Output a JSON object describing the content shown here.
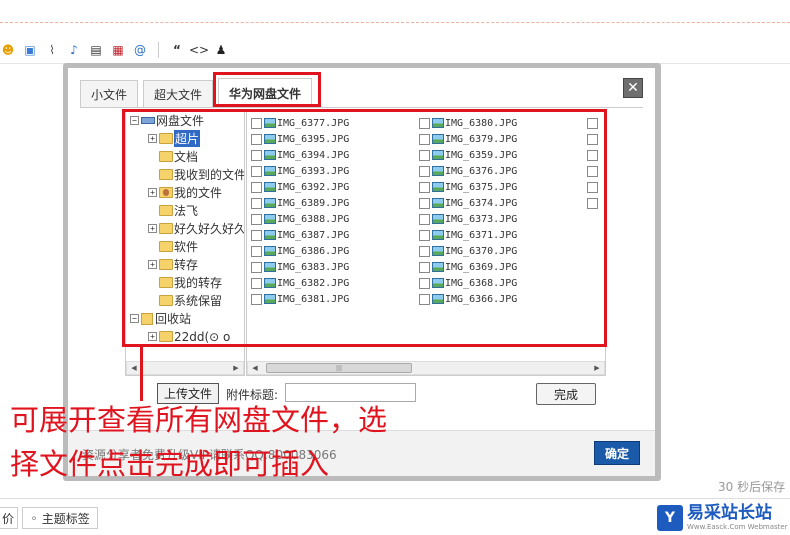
{
  "toolbar": {
    "icons": [
      "emoji-icon",
      "image-icon",
      "attachment-icon",
      "music-icon",
      "video-icon",
      "flash-icon",
      "at-icon",
      "quote-icon",
      "code-icon",
      "qq-icon"
    ],
    "at_glyph": "@",
    "quote_glyph": "“",
    "code_glyph": "<>"
  },
  "dialog": {
    "tabs": [
      {
        "label": "小文件",
        "active": false
      },
      {
        "label": "超大文件",
        "active": false
      },
      {
        "label": "华为网盘文件",
        "active": true
      }
    ],
    "close_glyph": "✕",
    "tree": {
      "toggle_minus": "−",
      "toggle_plus": "+",
      "root": "网盘文件",
      "items": [
        "超片",
        "文档",
        "我收到的文件",
        "我的文件",
        "法飞",
        "好久好久好久",
        "软件",
        "转存",
        "我的转存",
        "系统保留"
      ],
      "recycle": "回收站",
      "recycle_child": "22dd(⊙ o"
    },
    "files_col1": [
      "IMG_6377.JPG",
      "IMG_6395.JPG",
      "IMG_6394.JPG",
      "IMG_6393.JPG",
      "IMG_6392.JPG",
      "IMG_6389.JPG",
      "IMG_6388.JPG",
      "IMG_6387.JPG",
      "IMG_6386.JPG",
      "IMG_6383.JPG",
      "IMG_6382.JPG",
      "IMG_6381.JPG"
    ],
    "files_col2": [
      "IMG_6380.JPG",
      "IMG_6379.JPG",
      "IMG_6359.JPG",
      "IMG_6376.JPG",
      "IMG_6375.JPG",
      "IMG_6374.JPG",
      "IMG_6373.JPG",
      "IMG_6371.JPG",
      "IMG_6370.JPG",
      "IMG_6369.JPG",
      "IMG_6368.JPG",
      "IMG_6366.JPG"
    ],
    "scroll_arrow_left": "◀",
    "scroll_arrow_right": "▶",
    "scroll_grip": "|||",
    "upload_label": "上传文件",
    "attach_label": "附件标题:",
    "attach_value": "",
    "done_label": "完成",
    "footer_text": "资源分享者免费升级VIP请联系QQ:800083066",
    "ok_label": "确定"
  },
  "annotation": {
    "line1": "可展开查看所有网盘文件，选",
    "line2": "择文件点击完成即可插入"
  },
  "editor": {
    "autosave": "30 秒后保存",
    "left_tag": "价",
    "tag_label": "主题标签",
    "tag_glyph": "∘"
  },
  "logo": {
    "mark": "Y",
    "main": "易采站长站",
    "sub": "Www.Easck.Com Webmaster"
  },
  "colors": {
    "annotation_red": "#e0141e",
    "ok_blue": "#1a5aa8",
    "selection_blue": "#316ac5"
  }
}
